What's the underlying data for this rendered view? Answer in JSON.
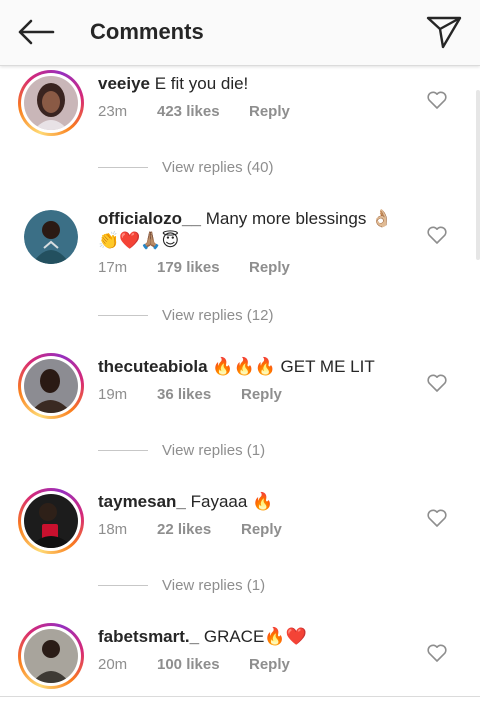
{
  "header": {
    "title": "Comments",
    "back_icon": "arrow-left-icon",
    "send_icon": "paper-plane-icon"
  },
  "comments": [
    {
      "username": "veeiye",
      "text": "E fit you die!",
      "time": "23m",
      "likes": "423 likes",
      "reply": "Reply",
      "view_replies": "View replies (40)"
    },
    {
      "username": "officialozo__",
      "text": "Many more blessings 👌🏼 👏❤️🙏🏽😇",
      "time": "17m",
      "likes": "179 likes",
      "reply": "Reply",
      "view_replies": "View replies (12)"
    },
    {
      "username": "thecuteabiola",
      "text": "🔥🔥🔥 GET ME LIT",
      "time": "19m",
      "likes": "36 likes",
      "reply": "Reply",
      "view_replies": "View replies (1)"
    },
    {
      "username": "taymesan_",
      "text": "Fayaaa 🔥",
      "time": "18m",
      "likes": "22 likes",
      "reply": "Reply",
      "view_replies": "View replies (1)"
    },
    {
      "username": "fabetsmart._",
      "text": "GRACE🔥❤️",
      "time": "20m",
      "likes": "100 likes",
      "reply": "Reply"
    }
  ],
  "colors": {
    "text": "#262626",
    "secondary": "#8e8e8e",
    "divider": "#dbdbdb",
    "header_bg": "#fafafa"
  }
}
